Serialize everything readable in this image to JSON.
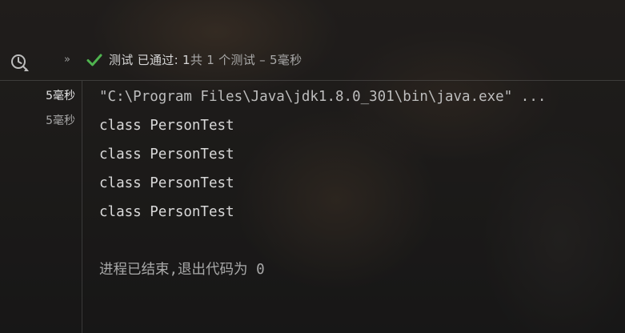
{
  "toolbar": {
    "history_icon": "clock-history-icon",
    "expand_glyph": "»",
    "pass_icon": "checkmark-icon",
    "status": {
      "prefix": "测试 已通过: ",
      "passed": "1",
      "suffix": "共 1 个测试 – 5毫秒"
    }
  },
  "tree": {
    "durations": [
      "5毫秒",
      "5毫秒"
    ]
  },
  "console": {
    "command": "\"C:\\Program Files\\Java\\jdk1.8.0_301\\bin\\java.exe\" ...",
    "output": [
      "class PersonTest",
      "class PersonTest",
      "class PersonTest",
      "class PersonTest"
    ],
    "exit_message": "进程已结束,退出代码为 0"
  },
  "colors": {
    "pass_green": "#4fb34f",
    "text": "#d9d9d9",
    "muted": "#a8a8a8"
  }
}
